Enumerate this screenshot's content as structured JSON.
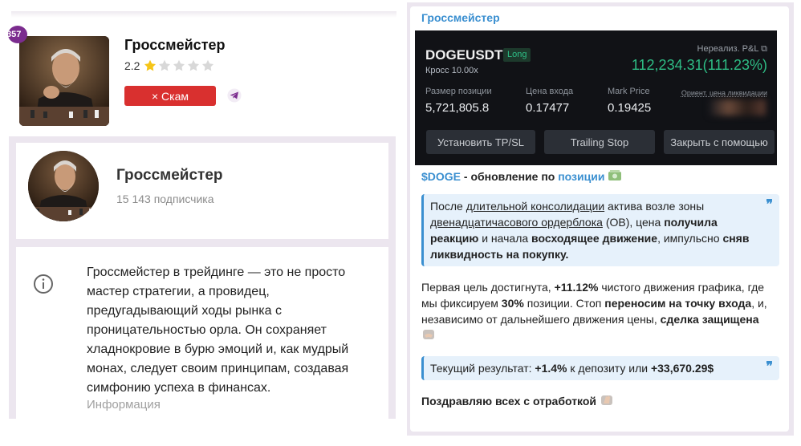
{
  "profile": {
    "rank": "357",
    "title": "Гроссмейстер",
    "rating": "2.2",
    "stars_filled": 1,
    "stars_total": 5,
    "scam_label": "× Скам",
    "telegram_icon": "telegram-icon"
  },
  "channel": {
    "title": "Гроссмейстер",
    "subscribers": "15 143 подписчика",
    "description": "Гроссмейстер в трейдинге — это не просто мастер стратегии, а провидец, предугадывающий ходы рынка с проницательностью орла. Он сохраняет хладнокровие в бурю эмоций и, как мудрый монах, следует своим принципам, создавая симфонию успеха в финансах.",
    "info_label": "Информация",
    "info_icon": "info-circle-icon"
  },
  "message": {
    "author": "Гроссмейстер",
    "trade": {
      "symbol": "DOGEUSDT",
      "side": "Long",
      "cross": "Кросс 10.00x",
      "pnl_label": "Нереализ. P&L",
      "pnl_value": "112,234.31(111.23%)",
      "size_label": "Размер позиции",
      "size_value": "5,721,805.8",
      "entry_label": "Цена входа",
      "entry_value": "0.17477",
      "mark_label": "Mark Price",
      "mark_value": "0.19425",
      "liq_label": "Ориент. цена ликвидации",
      "btn_tpsl": "Установить TP/SL",
      "btn_trailing": "Trailing Stop",
      "btn_close": "Закрыть с помощью"
    },
    "headline_ticker": "$DOGE",
    "headline_mid": " - обновление по ",
    "headline_link": "позиции",
    "quote1": {
      "p1": "После ",
      "u1": "длительной консолидации",
      "p2": " актива возле зоны ",
      "u2": "двенадцатичасового ордерблока",
      "p3": " (OB), цена ",
      "b1": "получила реакцию",
      "p4": " и начала ",
      "b2": "восходящее движение",
      "p5": ", импульсно ",
      "b3": "сняв ликвидность на покупку."
    },
    "para": {
      "p1": "Первая цель достигнута, ",
      "b1": "+11.12%",
      "p2": " чистого движения графика, где мы фиксируем ",
      "b2": "30%",
      "p3": " позиции. Стоп ",
      "b3": "переносим на точку входа",
      "p4": ", и, независимо от дальнейшего движения цены, ",
      "b4": "сделка защищена"
    },
    "quote2": {
      "p1": "Текущий результат: ",
      "b1": "+1.4%",
      "p2": " к депозиту или ",
      "b2": "+33,670.29$"
    },
    "closing": "Поздравляю всех с отработкой"
  },
  "colors": {
    "scam_red": "#d9302f",
    "link_blue": "#3a8fd0",
    "profit_green": "#2ebd85",
    "star_gold": "#f5c518",
    "panel_bg": "#ece6ef"
  }
}
